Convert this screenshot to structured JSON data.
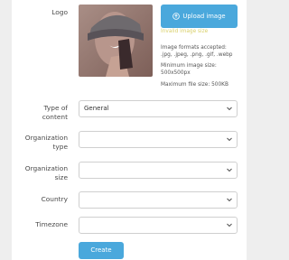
{
  "form": {
    "logo": {
      "label": "Logo",
      "upload_button": "Upload image",
      "invalid_text": "Invalid image size",
      "hints": [
        "Image formats accepted:",
        ".jpg, .jpeg, .png, .gif, .webp",
        "Minimum image size:",
        "500x500px",
        "Maximum file size: 500KB"
      ]
    },
    "type_of_content": {
      "label_line1": "Type of",
      "label_line2": "content",
      "value": "General"
    },
    "organization_type": {
      "label_line1": "Organization",
      "label_line2": "type",
      "value": ""
    },
    "organization_size": {
      "label_line1": "Organization",
      "label_line2": "size",
      "value": ""
    },
    "country": {
      "label": "Country",
      "value": ""
    },
    "timezone": {
      "label": "Timezone",
      "value": ""
    },
    "create_button": "Create"
  },
  "colors": {
    "accent": "#4aa8dc",
    "warning": "#d9d06a"
  },
  "icons": {
    "upload": "upload-icon",
    "dropdown": "chevron-down-icon"
  }
}
